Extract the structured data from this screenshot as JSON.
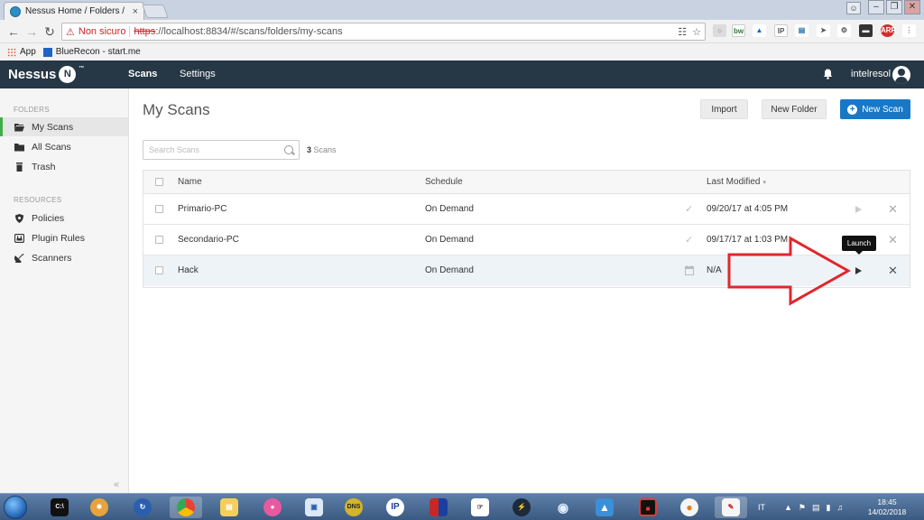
{
  "browser": {
    "tab_title": "Nessus Home / Folders /",
    "tab_close": "×",
    "not_secure": "Non sicuro",
    "url_scheme": "https",
    "url_rest": "://localhost:8834/#/scans/folders/my-scans",
    "bookmarks": [
      "App",
      "BlueRecon - start.me"
    ]
  },
  "header": {
    "logo": "Nessus",
    "logo_badge": "N",
    "logo_tm": "™",
    "nav": [
      "Scans",
      "Settings"
    ],
    "user": "intelresol"
  },
  "sidebar": {
    "folders_heading": "FOLDERS",
    "folders": [
      "My Scans",
      "All Scans",
      "Trash"
    ],
    "resources_heading": "RESOURCES",
    "resources": [
      "Policies",
      "Plugin Rules",
      "Scanners"
    ],
    "collapse": "«"
  },
  "main": {
    "title": "My Scans",
    "buttons": {
      "import": "Import",
      "new_folder": "New Folder",
      "new_scan": "New Scan"
    },
    "search_placeholder": "Search Scans",
    "count_number": "3",
    "count_label": "Scans",
    "columns": [
      "Name",
      "Schedule",
      "Last Modified"
    ],
    "rows": [
      {
        "name": "Primario-PC",
        "schedule": "On Demand",
        "modified": "09/20/17 at 4:05 PM"
      },
      {
        "name": "Secondario-PC",
        "schedule": "On Demand",
        "modified": "09/17/17 at 1:03 PM"
      },
      {
        "name": "Hack",
        "schedule": "On Demand",
        "modified": "N/A"
      }
    ],
    "tooltip": "Launch"
  },
  "taskbar": {
    "apps": [
      "C:\\",
      "DNS",
      "IP"
    ],
    "language": "IT",
    "time": "18:45",
    "date": "14/02/2018"
  },
  "colors": {
    "header_bg": "#263746",
    "accent_blue": "#1878c6",
    "active_green": "#3fae49",
    "arrow_red": "#e0262c"
  }
}
